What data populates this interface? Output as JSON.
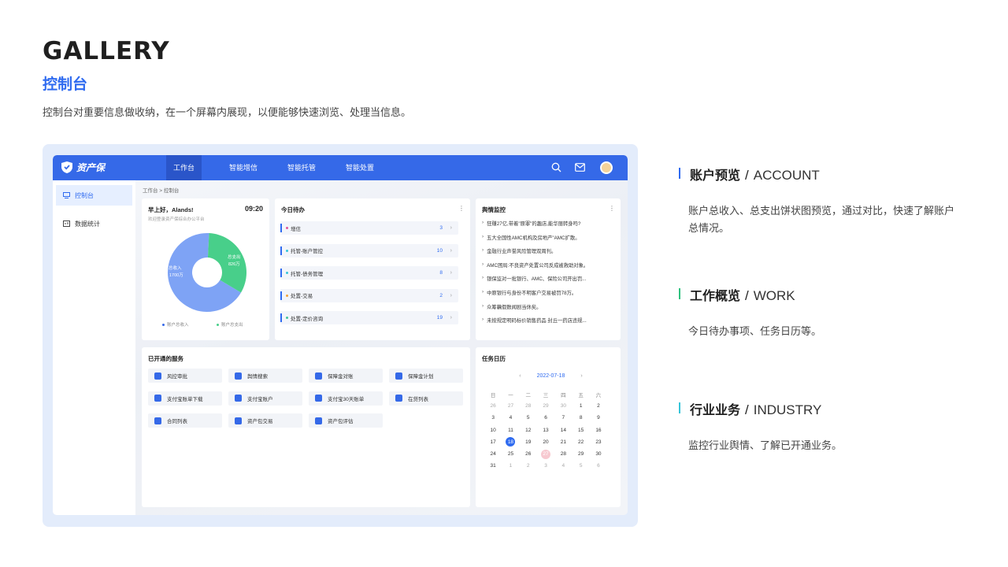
{
  "header": {
    "title": "GALLERY",
    "subtitle": "控制台",
    "description": "控制台对重要信息做收纳，在一个屏幕内展现，以便能够快速浏览、处理当信息。"
  },
  "app": {
    "logo_text": "资产保",
    "nav": [
      "工作台",
      "智能增信",
      "智能托管",
      "智能处置"
    ],
    "sidebar": [
      "控制台",
      "数据统计"
    ],
    "breadcrumb": "工作台 > 控制台",
    "account": {
      "greeting": "早上好，Alands!",
      "welcome": "欢迎登录资产保综合办公平台",
      "time": "09:20",
      "income_label": "总收入",
      "income_value": "1700万",
      "expense_label": "总支出",
      "expense_value": "826万",
      "income_fraction": 0.673,
      "legend_income": "账户总收入",
      "legend_expense": "账户总支出",
      "colors": {
        "income": "#7ea3f5",
        "expense": "#48cf8a"
      }
    },
    "todo": {
      "title": "今日待办",
      "items": [
        {
          "label": "增信",
          "count": "3",
          "color": "#e0559a"
        },
        {
          "label": "托管-账户管控",
          "count": "10",
          "color": "#36c5d9"
        },
        {
          "label": "托管-债务管理",
          "count": "8",
          "color": "#36c5d9"
        },
        {
          "label": "处置-交易",
          "count": "2",
          "color": "#f2a33a"
        },
        {
          "label": "处置-定价咨询",
          "count": "19",
          "color": "#42c59a"
        }
      ]
    },
    "news": {
      "title": "舆情监控",
      "items": [
        "狂赚27亿,带着\"原罪\"的趣店,能华丽转身吗?",
        "五大全国性AMC机构及房地产\"AMC扩散。",
        "金融行业声誉风险管理双周刊。",
        "AMC困局:不良资产处置公司反成被救助对象。",
        "银保监对一批银行、AMC、保险公司开出罚...",
        "中原银行与身份不明客户交易被罚78万。",
        "众筹藕假数闻剧当休矣。",
        "未按规定明码标价销售药品 封丘一药店违规..."
      ]
    },
    "services": {
      "title": "已开通的服务",
      "items": [
        "风控审批",
        "舆情搜索",
        "保障金对账",
        "保障金计划",
        "支付宝账单下载",
        "支付宝账户",
        "支付宝30天账单",
        "在贷列表",
        "合同列表",
        "资产包交易",
        "资产包评估"
      ]
    },
    "calendar": {
      "title": "任务日历",
      "month": "2022-07-18",
      "weekdays": [
        "日",
        "一",
        "二",
        "三",
        "四",
        "五",
        "六"
      ],
      "days": [
        {
          "d": "26",
          "off": true
        },
        {
          "d": "27",
          "off": true
        },
        {
          "d": "28",
          "off": true
        },
        {
          "d": "29",
          "off": true
        },
        {
          "d": "30",
          "off": true
        },
        {
          "d": "1"
        },
        {
          "d": "2"
        },
        {
          "d": "3"
        },
        {
          "d": "4"
        },
        {
          "d": "5"
        },
        {
          "d": "6"
        },
        {
          "d": "7"
        },
        {
          "d": "8"
        },
        {
          "d": "9"
        },
        {
          "d": "10"
        },
        {
          "d": "11"
        },
        {
          "d": "12"
        },
        {
          "d": "13"
        },
        {
          "d": "14"
        },
        {
          "d": "15"
        },
        {
          "d": "16"
        },
        {
          "d": "17"
        },
        {
          "d": "18",
          "today": true
        },
        {
          "d": "19"
        },
        {
          "d": "20"
        },
        {
          "d": "21"
        },
        {
          "d": "22"
        },
        {
          "d": "23"
        },
        {
          "d": "24"
        },
        {
          "d": "25"
        },
        {
          "d": "26"
        },
        {
          "d": "27",
          "marked": true
        },
        {
          "d": "28"
        },
        {
          "d": "29"
        },
        {
          "d": "30"
        },
        {
          "d": "31"
        },
        {
          "d": "1",
          "off": true
        },
        {
          "d": "2",
          "off": true
        },
        {
          "d": "3",
          "off": true
        },
        {
          "d": "4",
          "off": true
        },
        {
          "d": "5",
          "off": true
        },
        {
          "d": "6",
          "off": true
        }
      ]
    }
  },
  "sections": [
    {
      "cn": "账户预览",
      "en": "ACCOUNT",
      "desc": "账户总收入、总支出饼状图预览，通过对比，快速了解账户总情况。",
      "color": "#2f6bf0"
    },
    {
      "cn": "工作概览",
      "en": "WORK",
      "desc": "今日待办事项、任务日历等。",
      "color": "#2fc27f"
    },
    {
      "cn": "行业业务",
      "en": "INDUSTRY",
      "desc": "监控行业舆情、了解已开通业务。",
      "color": "#36c5d9"
    }
  ]
}
